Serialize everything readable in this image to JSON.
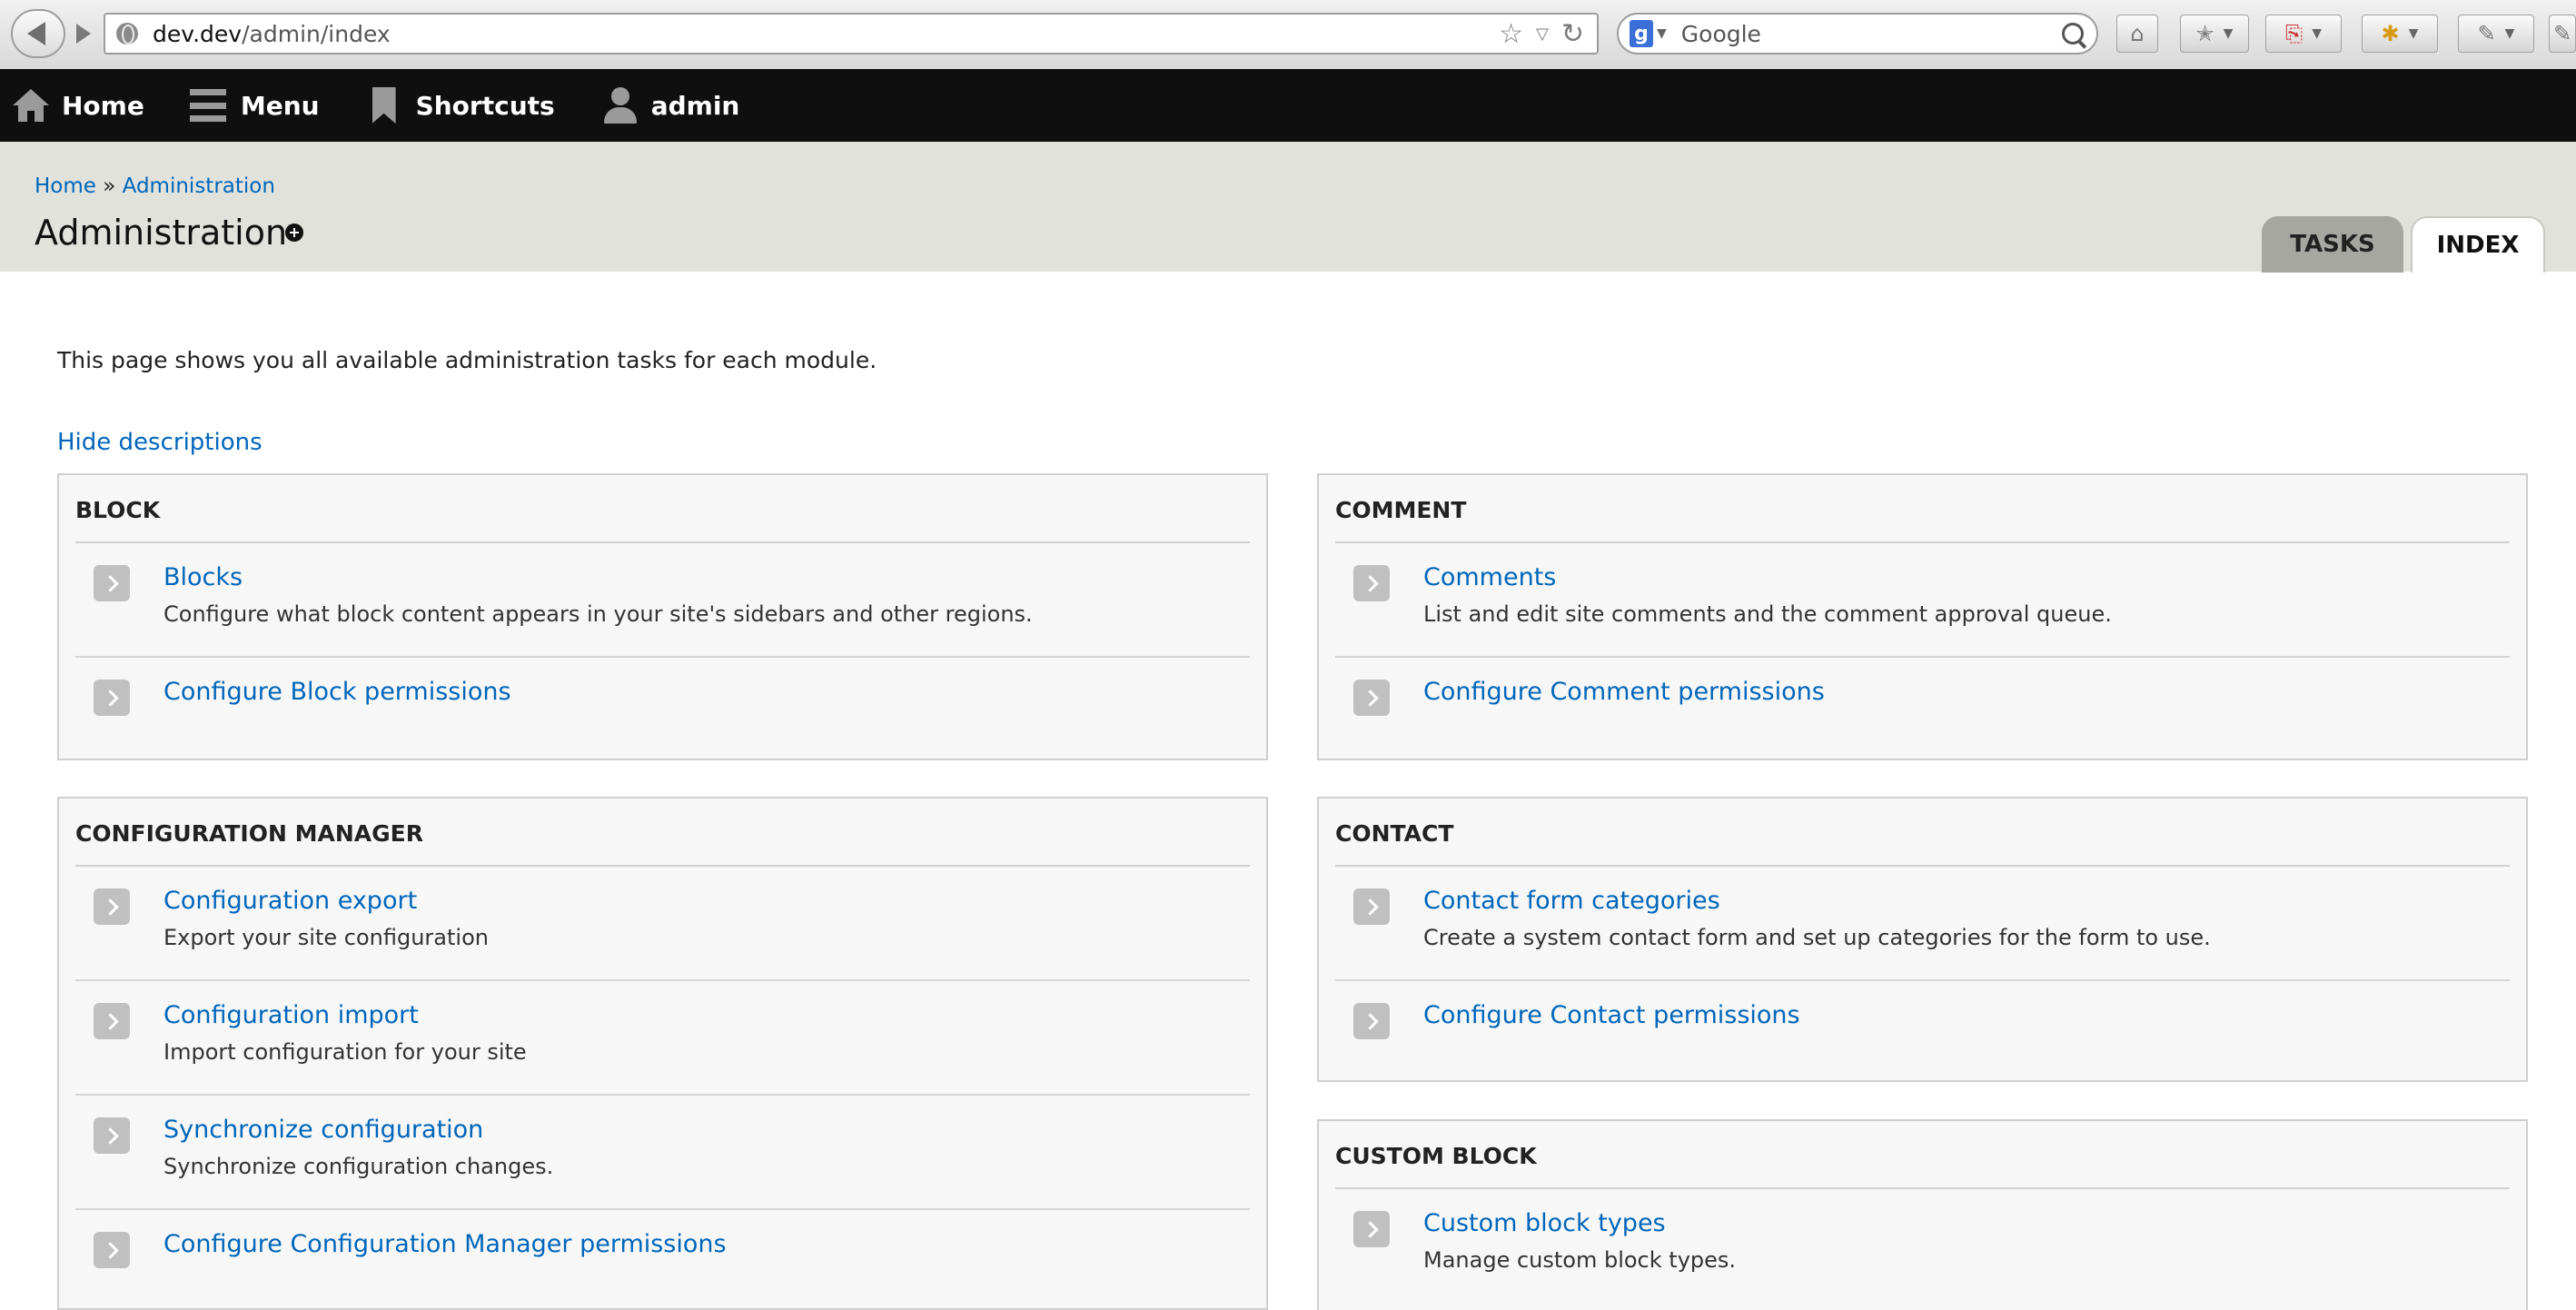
{
  "browser": {
    "url_host": "dev.dev",
    "url_path": "/admin/index",
    "search_placeholder": "Google"
  },
  "toolbar": {
    "home": "Home",
    "menu": "Menu",
    "shortcuts": "Shortcuts",
    "user": "admin"
  },
  "header": {
    "breadcrumb": {
      "home": "Home",
      "sep": "»",
      "current": "Administration"
    },
    "title": "Administration",
    "tabs": {
      "tasks": "TASKS",
      "index": "INDEX"
    }
  },
  "content": {
    "intro": "This page shows you all available administration tasks for each module.",
    "hide_descriptions": "Hide descriptions",
    "panels": {
      "block": {
        "title": "BLOCK",
        "items": [
          {
            "link": "Blocks",
            "desc": "Configure what block content appears in your site's sidebars and other regions."
          },
          {
            "link": "Configure Block permissions"
          }
        ]
      },
      "comment": {
        "title": "COMMENT",
        "items": [
          {
            "link": "Comments",
            "desc": "List and edit site comments and the comment approval queue."
          },
          {
            "link": "Configure Comment permissions"
          }
        ]
      },
      "config": {
        "title": "CONFIGURATION MANAGER",
        "items": [
          {
            "link": "Configuration export",
            "desc": "Export your site configuration"
          },
          {
            "link": "Configuration import",
            "desc": "Import configuration for your site"
          },
          {
            "link": "Synchronize configuration",
            "desc": "Synchronize configuration changes."
          },
          {
            "link": "Configure Configuration Manager permissions"
          }
        ]
      },
      "contact": {
        "title": "CONTACT",
        "items": [
          {
            "link": "Contact form categories",
            "desc": "Create a system contact form and set up categories for the form to use."
          },
          {
            "link": "Configure Contact permissions"
          }
        ]
      },
      "custom_block": {
        "title": "CUSTOM BLOCK",
        "items": [
          {
            "link": "Custom block types",
            "desc": "Manage custom block types."
          }
        ]
      }
    }
  }
}
